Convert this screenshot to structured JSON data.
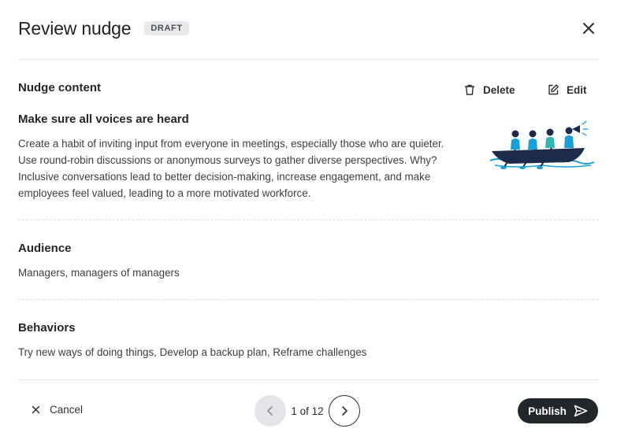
{
  "header": {
    "title": "Review nudge",
    "badge": "DRAFT"
  },
  "nudge_content": {
    "section_title": "Nudge content",
    "delete_label": "Delete",
    "edit_label": "Edit",
    "heading": "Make sure all voices are heard",
    "body": "Create a habit of inviting input from everyone in meetings, especially those who are quieter. Use round-robin discussions or anonymous surveys to gather diverse perspectives. Why? Inclusive conversations lead to better decision-making, increase engagement, and make employees feel valued, leading to a more motivated workforce."
  },
  "audience": {
    "section_title": "Audience",
    "value": "Managers, managers of managers"
  },
  "behaviors": {
    "section_title": "Behaviors",
    "value": "Try new ways of doing things, Develop a backup plan, Reframe challenges"
  },
  "footer": {
    "cancel_label": "Cancel",
    "pager_label": "1 of 12",
    "publish_label": "Publish"
  },
  "colors": {
    "primary_dark": "#22272c",
    "badge_bg": "#e8e9eb",
    "illustration_blue": "#1a9fd6",
    "illustration_navy": "#1c2b4a"
  },
  "icons": {
    "close": "close-icon",
    "delete": "trash-icon",
    "edit": "edit-icon",
    "cancel": "x-icon",
    "prev": "chevron-left-icon",
    "next": "chevron-right-icon",
    "publish": "send-icon"
  }
}
